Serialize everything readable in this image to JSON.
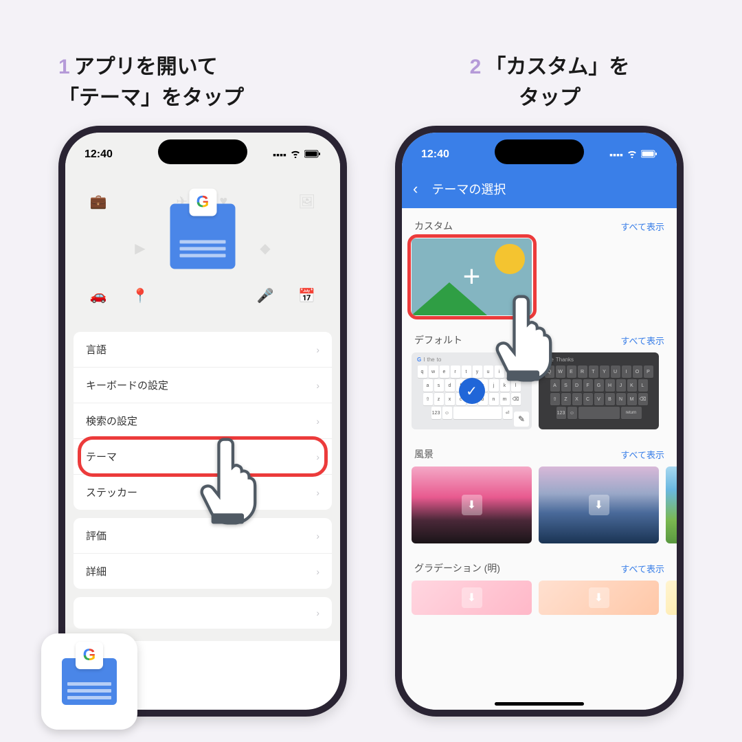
{
  "step1": {
    "num": "1",
    "text": "アプリを開いて\n「テーマ」をタップ"
  },
  "step2": {
    "num": "2",
    "text": "「カスタム」を\nタップ"
  },
  "status": {
    "time": "12:40"
  },
  "p1": {
    "items": [
      "言語",
      "キーボードの設定",
      "検索の設定",
      "テーマ",
      "ステッカー",
      "評価",
      "詳細"
    ]
  },
  "p2": {
    "header": "テーマの選択",
    "sec_custom": "カスタム",
    "sec_default": "デフォルト",
    "sec_scenery": "風景",
    "sec_gradient": "グラデーション (明)",
    "show_all": "すべて表示",
    "kb_top": {
      "g": "G",
      "w1": "I",
      "w2": "the",
      "w3": "to"
    },
    "kb_top_dark": {
      "w1": "The",
      "w2": "Thanks"
    }
  }
}
